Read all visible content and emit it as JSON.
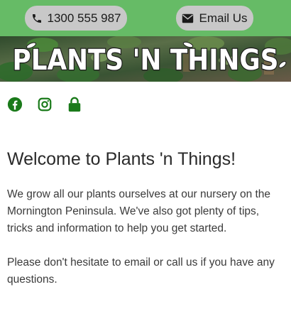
{
  "header": {
    "phone_label": "1300 555 987",
    "email_label": "Email Us"
  },
  "banner": {
    "logo_text": "PLANTS 'N THINGS"
  },
  "social": {
    "icons": [
      "facebook-icon",
      "instagram-icon",
      "lock-icon"
    ],
    "color": "#1a7a1a"
  },
  "main": {
    "heading": "Welcome to Plants 'n Things!",
    "paragraph1": "We grow all our plants ourselves at our nursery on the Mornington Peninsula. We've also got plenty of tips, tricks and information to help you get started.",
    "paragraph2": "Please don't hesitate to email or call us if you have any questions."
  },
  "colors": {
    "header_bg": "#66bb66",
    "pill_bg": "#c8c8c8",
    "text": "#3a3a3a"
  }
}
